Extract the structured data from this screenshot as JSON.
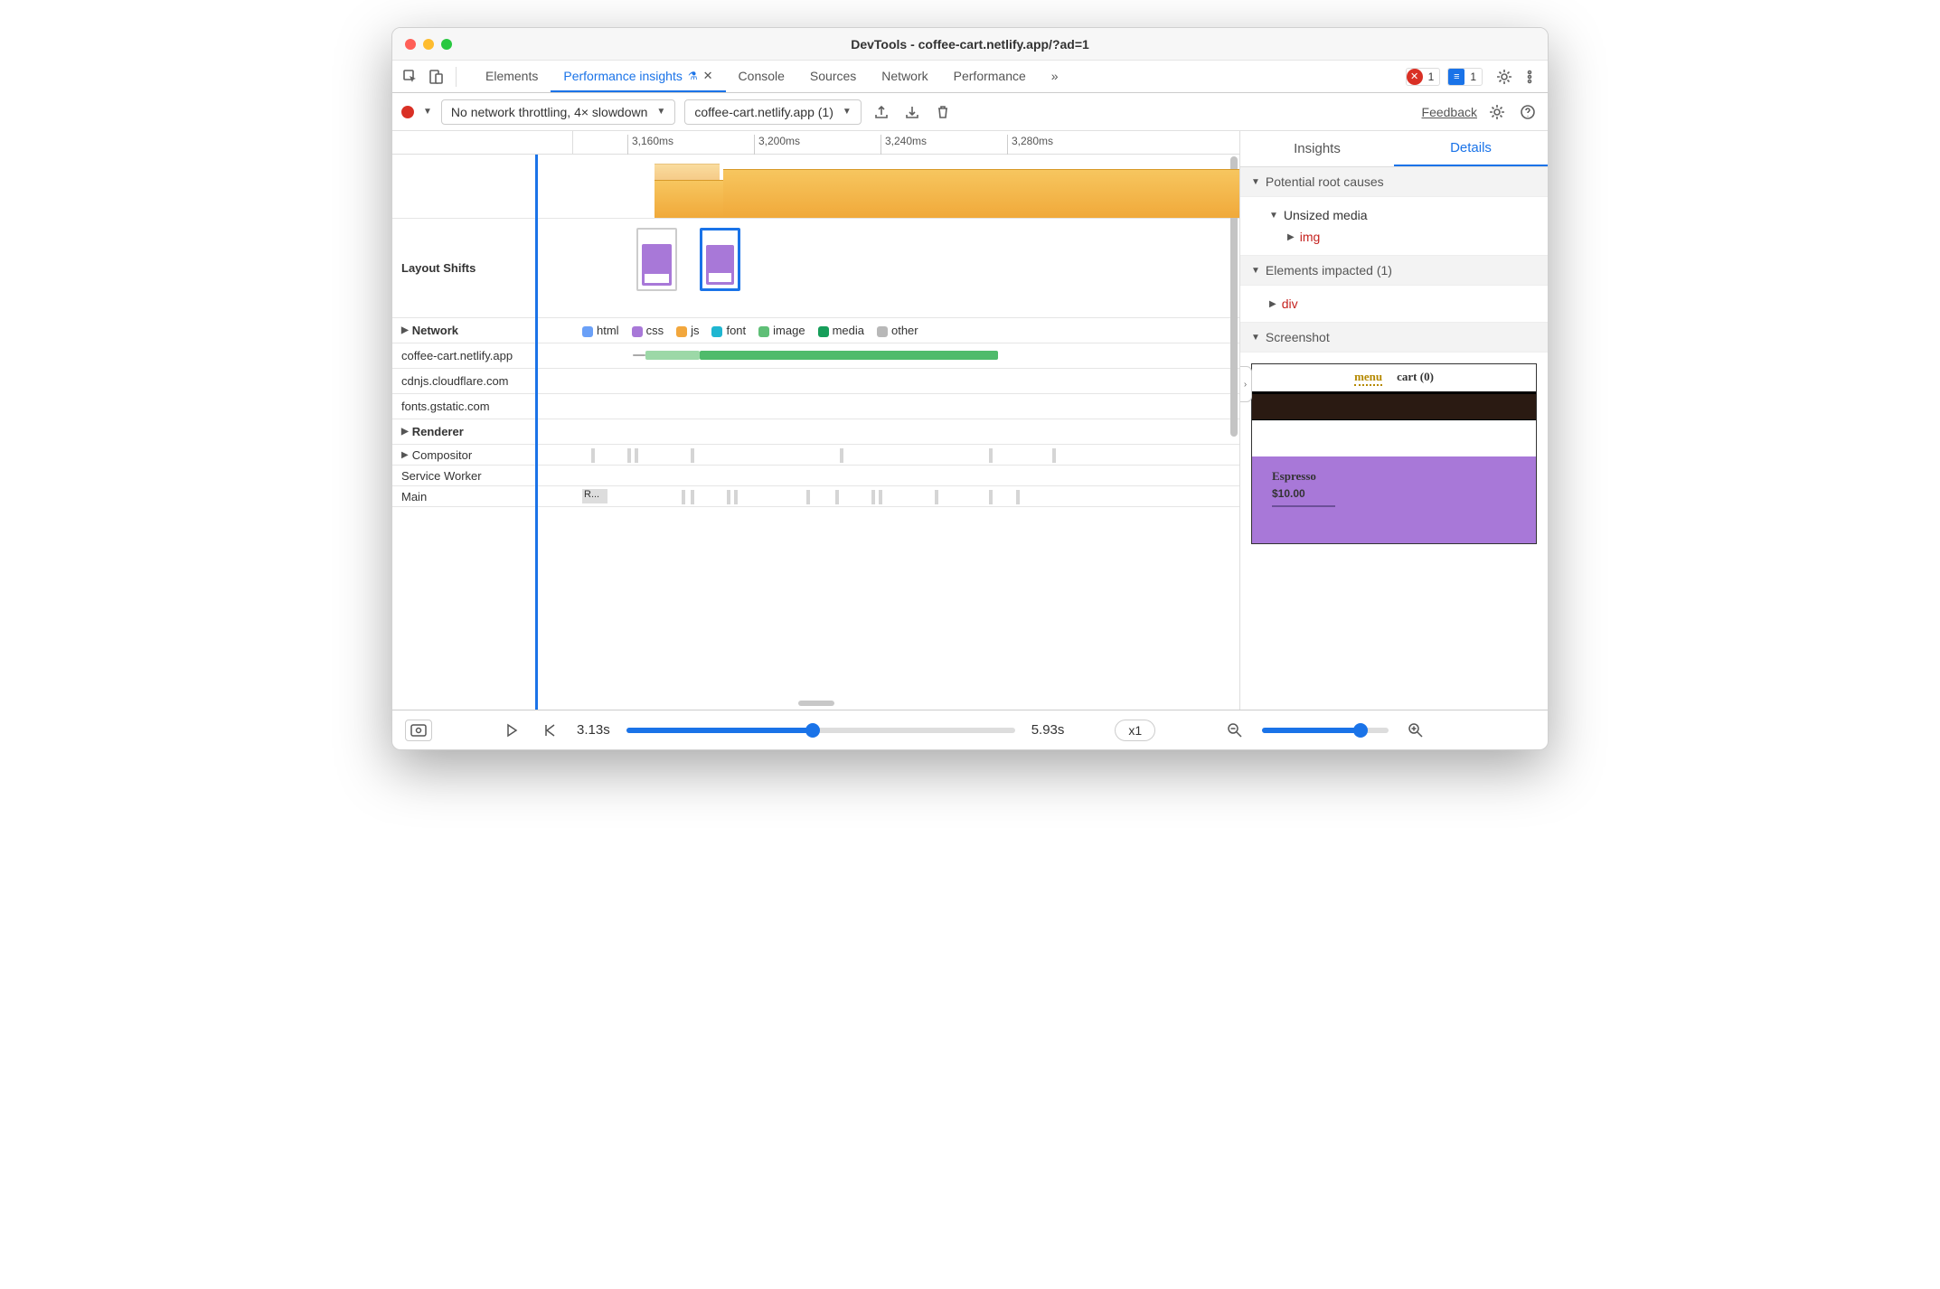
{
  "window_title": "DevTools - coffee-cart.netlify.app/?ad=1",
  "tabs": {
    "elements": "Elements",
    "perf_insights": "Performance insights",
    "console": "Console",
    "sources": "Sources",
    "network": "Network",
    "performance": "Performance"
  },
  "badges": {
    "errors": "1",
    "messages": "1"
  },
  "toolbar": {
    "throttling": "No network throttling, 4× slowdown",
    "target": "coffee-cart.netlify.app (1)",
    "feedback": "Feedback"
  },
  "ruler": {
    "t1": "3,160ms",
    "t2": "3,200ms",
    "t3": "3,240ms",
    "t4": "3,280ms"
  },
  "rows": {
    "layout_shifts": "Layout Shifts",
    "network": "Network",
    "renderer": "Renderer",
    "compositor": "Compositor",
    "service_worker": "Service Worker",
    "main": "Main"
  },
  "legend": {
    "html": "html",
    "css": "css",
    "js": "js",
    "font": "font",
    "image": "image",
    "media": "media",
    "other": "other"
  },
  "network_hosts": {
    "h1": "coffee-cart.netlify.app",
    "h2": "cdnjs.cloudflare.com",
    "h3": "fonts.gstatic.com"
  },
  "main_task": "R...",
  "sidepanel": {
    "tab_insights": "Insights",
    "tab_details": "Details",
    "sec_root": "Potential root causes",
    "item_unsized": "Unsized media",
    "item_img": "img",
    "sec_impacted": "Elements impacted (1)",
    "item_div": "div",
    "sec_screenshot": "Screenshot"
  },
  "screenshot": {
    "menu": "menu",
    "cart": "cart (0)",
    "product_name": "Espresso",
    "product_price": "$10.00"
  },
  "footer": {
    "time_start": "3.13s",
    "time_end": "5.93s",
    "speed": "x1"
  }
}
